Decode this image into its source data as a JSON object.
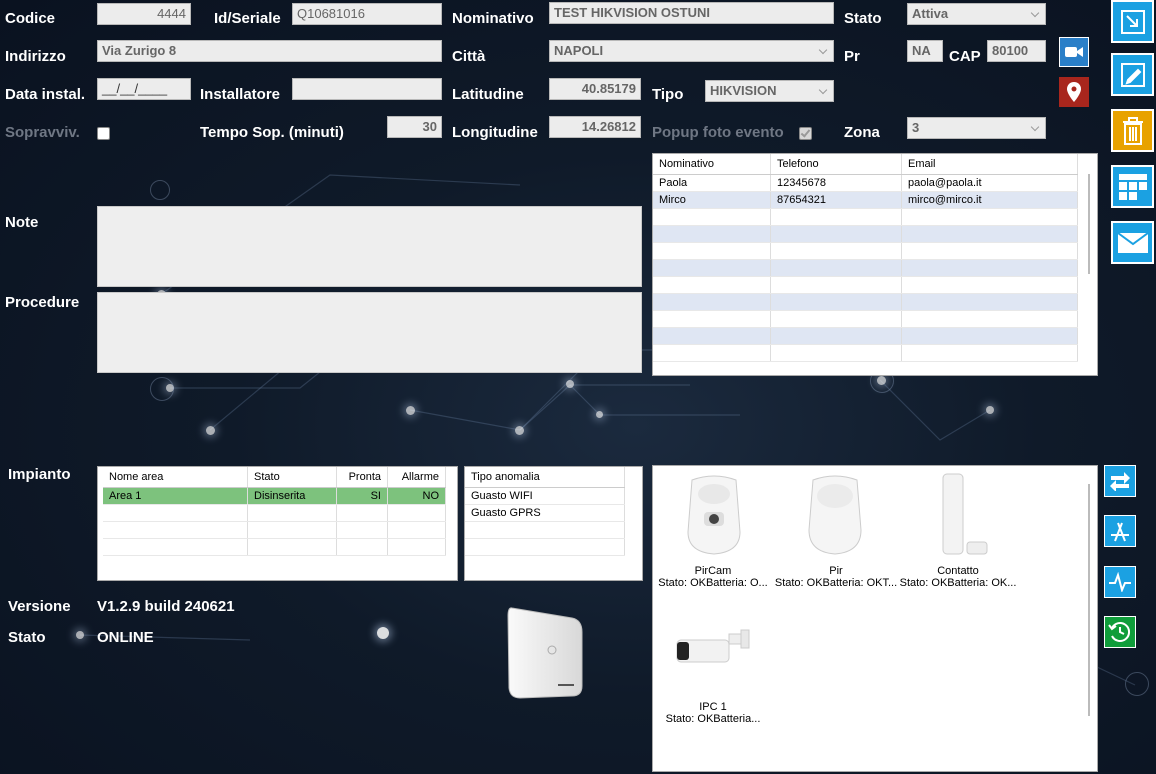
{
  "labels": {
    "codice": "Codice",
    "idseriale": "Id/Seriale",
    "nominativo": "Nominativo",
    "stato": "Stato",
    "indirizzo": "Indirizzo",
    "citta": "Città",
    "pr": "Pr",
    "cap": "CAP",
    "data_instal": "Data instal.",
    "installatore": "Installatore",
    "latitudine": "Latitudine",
    "tipo": "Tipo",
    "sopravviv": "Sopravviv.",
    "tempo_sop": "Tempo Sop. (minuti)",
    "longitudine": "Longitudine",
    "popup": "Popup foto evento",
    "zona": "Zona",
    "note": "Note",
    "procedure": "Procedure",
    "impianto": "Impianto",
    "versione": "Versione",
    "stato_conn": "Stato"
  },
  "fields": {
    "codice": "4444",
    "idseriale": "Q10681016",
    "nominativo": "TEST HIKVISION OSTUNI",
    "stato": "Attiva",
    "indirizzo": "Via Zurigo 8",
    "citta": "NAPOLI",
    "pr": "NA",
    "cap": "80100",
    "data_instal": "__/__/____",
    "installatore": "",
    "latitudine": "40.85179",
    "tipo": "HIKVISION",
    "tempo_sop": "30",
    "longitudine": "14.26812",
    "zona": "3"
  },
  "info": {
    "versione": "V1.2.9 build 240621",
    "stato": "ONLINE"
  },
  "contacts": {
    "headers": [
      "Nominativo",
      "Telefono",
      "Email"
    ],
    "rows": [
      [
        "Paola",
        "12345678",
        "paola@paola.it"
      ],
      [
        "Mirco",
        "87654321",
        "mirco@mirco.it"
      ]
    ]
  },
  "areas": {
    "headers": [
      "Nome area",
      "Stato",
      "Pronta",
      "Allarme"
    ],
    "rows": [
      [
        "Area 1",
        "Disinserita",
        "SI",
        "NO"
      ]
    ]
  },
  "anomalies": {
    "header": "Tipo anomalia",
    "rows": [
      "Guasto WIFI",
      "Guasto GPRS"
    ]
  },
  "devices": [
    {
      "name": "PirCam",
      "status": "Stato: OKBatteria: O..."
    },
    {
      "name": "Pir",
      "status": "Stato: OKBatteria: OKT..."
    },
    {
      "name": "Contatto",
      "status": "Stato: OKBatteria: OK..."
    },
    {
      "name": "IPC 1",
      "status": "Stato: OKBatteria..."
    }
  ],
  "colors": {
    "accent": "#1ba1e2",
    "orange": "#e8a200",
    "green": "#0f9d3a",
    "red": "#a8261d",
    "camera_blue": "#2a7fc8",
    "area_row": "#7dc27d"
  }
}
